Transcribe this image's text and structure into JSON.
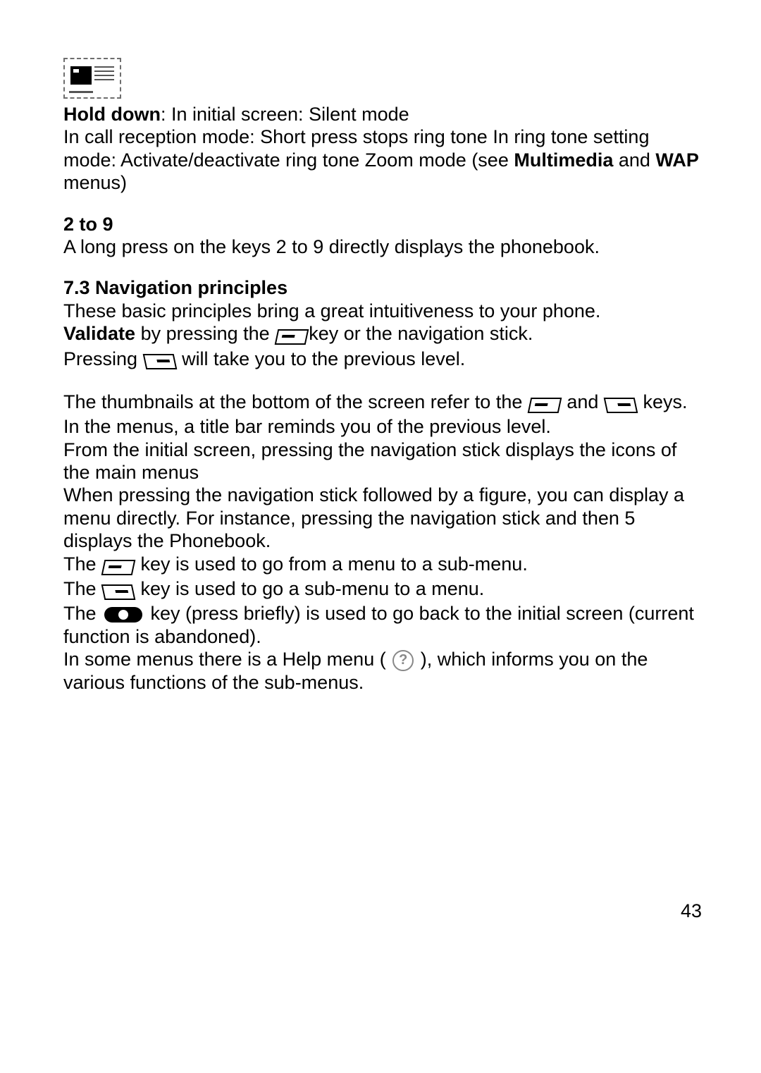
{
  "page_number": "43",
  "block1": {
    "hold_down_label": "Hold down",
    "hold_down_rest": ": In initial screen: Silent mode",
    "line2a": "In call reception mode: Short press stops ring tone In ring tone setting mode: Activate/deactivate ring tone Zoom mode (see ",
    "mm": "Multimedia",
    "and": " and ",
    "wap": "WAP",
    "line2b": " menus)"
  },
  "block2": {
    "heading": "2 to 9",
    "text": "A long press on the keys 2 to 9 directly displays the phonebook."
  },
  "nav": {
    "heading": "7.3 Navigation principles",
    "intro": "These basic principles bring a great intuitiveness to your phone.",
    "validate_label": "Validate",
    "validate_rest_a": "  by pressing the ",
    "validate_rest_b": "key or the navigation stick.",
    "pressing_a": "Pressing  ",
    "pressing_b": "  will take you to the previous level.",
    "thumbs_a": "The thumbnails at the bottom of the screen refer to the  ",
    "thumbs_and": "   and  ",
    "thumbs_b": "  keys.",
    "reminds": "In the menus, a title bar reminds you of the previous level.",
    "initial": "From the initial screen, pressing the navigation stick displays the icons of the main menus",
    "figure": "When pressing the navigation stick followed by a figure, you can display a menu directly. For instance, pressing the navigation stick and then 5 displays the Phonebook.",
    "the": "The  ",
    "left_key_text": "  key is used to go from a menu to a sub-menu.",
    "right_key_text": "  key is used to go a sub-menu to a menu.",
    "end_key_text": "  key (press briefly) is used to go back to the initial screen (current function is abandoned).",
    "help_a": "In some menus there is a Help menu ( ",
    "help_b": " ), which informs you on the various functions of the sub-menus."
  }
}
